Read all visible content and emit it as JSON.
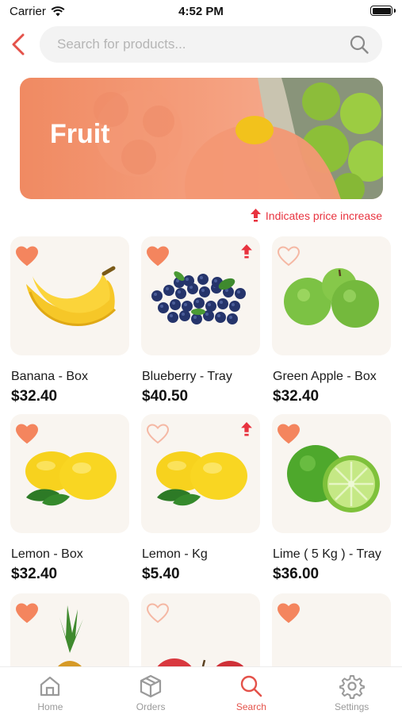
{
  "status": {
    "carrier": "Carrier",
    "time": "4:52 PM"
  },
  "search": {
    "placeholder": "Search for products..."
  },
  "banner": {
    "title": "Fruit"
  },
  "price_note": {
    "text": "Indicates price increase"
  },
  "colors": {
    "accent": "#e4524a",
    "heart": "#f4855e",
    "banner": "#f08a62",
    "price_up": "#e8333f"
  },
  "products": [
    {
      "name": "Banana - Box",
      "price": "$32.40",
      "favorite": true,
      "price_up": false,
      "image": "banana"
    },
    {
      "name": "Blueberry - Tray",
      "price": "$40.50",
      "favorite": true,
      "price_up": true,
      "image": "blueberry"
    },
    {
      "name": "Green Apple - Box",
      "price": "$32.40",
      "favorite": false,
      "price_up": false,
      "image": "green-apple"
    },
    {
      "name": "Lemon - Box",
      "price": "$32.40",
      "favorite": true,
      "price_up": false,
      "image": "lemon"
    },
    {
      "name": "Lemon - Kg",
      "price": "$5.40",
      "favorite": false,
      "price_up": true,
      "image": "lemon"
    },
    {
      "name": "Lime ( 5 Kg ) - Tray",
      "price": "$36.00",
      "favorite": true,
      "price_up": false,
      "image": "lime"
    },
    {
      "name": "",
      "price": "",
      "favorite": true,
      "price_up": false,
      "image": "pineapple"
    },
    {
      "name": "",
      "price": "",
      "favorite": false,
      "price_up": false,
      "image": "red-apple"
    },
    {
      "name": "",
      "price": "",
      "favorite": true,
      "price_up": false,
      "image": "watermelon"
    }
  ],
  "tabs": [
    {
      "label": "Home",
      "icon": "home-icon",
      "active": false
    },
    {
      "label": "Orders",
      "icon": "box-icon",
      "active": false
    },
    {
      "label": "Search",
      "icon": "search-icon",
      "active": true
    },
    {
      "label": "Settings",
      "icon": "gear-icon",
      "active": false
    }
  ]
}
